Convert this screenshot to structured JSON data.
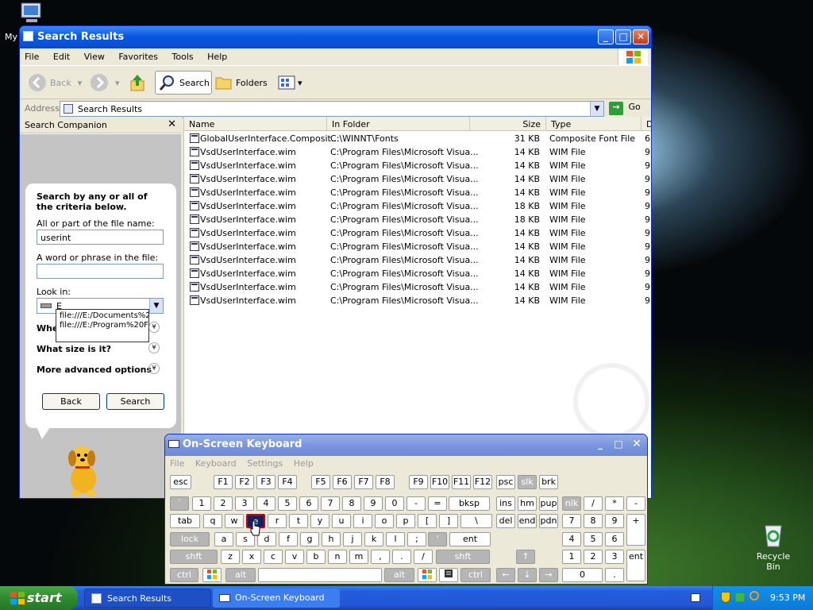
{
  "desktop": {
    "my_label": "My",
    "recycle_bin": "Recycle Bin"
  },
  "search_window": {
    "title": "Search Results",
    "menu": [
      "File",
      "Edit",
      "View",
      "Favorites",
      "Tools",
      "Help"
    ],
    "toolbar": {
      "back": "Back",
      "search": "Search",
      "folders": "Folders"
    },
    "address": {
      "label": "Address",
      "value": "Search Results",
      "go": "Go"
    },
    "companion": {
      "title": "Search Companion",
      "intro": "Search by any or all of the criteria below.",
      "name_label": "All or part of the file name:",
      "name_value": "userint",
      "phrase_label": "A word or phrase in the file:",
      "phrase_value": "",
      "lookin_label": "Look in:",
      "lookin_value": "E",
      "suggestions": [
        "file:///E:/Documents%2",
        "file:///E:/Program%20F"
      ],
      "when_label": "Whe",
      "size_label": "What size is it?",
      "advanced_label": "More advanced options",
      "back_btn": "Back",
      "search_btn": "Search"
    },
    "columns": [
      "Name",
      "In Folder",
      "Size",
      "Type",
      "D"
    ],
    "rows": [
      {
        "name": "GlobalUserInterface.Composit...",
        "folder": "C:\\WINNT\\Fonts",
        "size": "31 KB",
        "type": "Composite Font File",
        "d": "6"
      },
      {
        "name": "VsdUserInterface.wim",
        "folder": "C:\\Program Files\\Microsoft Visua...",
        "size": "14 KB",
        "type": "WIM File",
        "d": "9"
      },
      {
        "name": "VsdUserInterface.wim",
        "folder": "C:\\Program Files\\Microsoft Visua...",
        "size": "14 KB",
        "type": "WIM File",
        "d": "9"
      },
      {
        "name": "VsdUserInterface.wim",
        "folder": "C:\\Program Files\\Microsoft Visua...",
        "size": "14 KB",
        "type": "WIM File",
        "d": "9"
      },
      {
        "name": "VsdUserInterface.wim",
        "folder": "C:\\Program Files\\Microsoft Visua...",
        "size": "14 KB",
        "type": "WIM File",
        "d": "9"
      },
      {
        "name": "VsdUserInterface.wim",
        "folder": "C:\\Program Files\\Microsoft Visua...",
        "size": "18 KB",
        "type": "WIM File",
        "d": "9"
      },
      {
        "name": "VsdUserInterface.wim",
        "folder": "C:\\Program Files\\Microsoft Visua...",
        "size": "18 KB",
        "type": "WIM File",
        "d": "9"
      },
      {
        "name": "VsdUserInterface.wim",
        "folder": "C:\\Program Files\\Microsoft Visua...",
        "size": "14 KB",
        "type": "WIM File",
        "d": "9"
      },
      {
        "name": "VsdUserInterface.wim",
        "folder": "C:\\Program Files\\Microsoft Visua...",
        "size": "14 KB",
        "type": "WIM File",
        "d": "9"
      },
      {
        "name": "VsdUserInterface.wim",
        "folder": "C:\\Program Files\\Microsoft Visua...",
        "size": "14 KB",
        "type": "WIM File",
        "d": "9"
      },
      {
        "name": "VsdUserInterface.wim",
        "folder": "C:\\Program Files\\Microsoft Visua...",
        "size": "14 KB",
        "type": "WIM File",
        "d": "9"
      },
      {
        "name": "VsdUserInterface.wim",
        "folder": "C:\\Program Files\\Microsoft Visua...",
        "size": "14 KB",
        "type": "WIM File",
        "d": "9"
      },
      {
        "name": "VsdUserInterface.wim",
        "folder": "C:\\Program Files\\Microsoft Visua...",
        "size": "14 KB",
        "type": "WIM File",
        "d": "9"
      }
    ]
  },
  "osk": {
    "title": "On-Screen Keyboard",
    "menu": [
      "File",
      "Keyboard",
      "Settings",
      "Help"
    ],
    "row0": [
      "esc",
      "F1",
      "F2",
      "F3",
      "F4",
      "F5",
      "F6",
      "F7",
      "F8",
      "F9",
      "F10",
      "F11",
      "F12",
      "psc",
      "slk",
      "brk"
    ],
    "row1": [
      "`",
      "1",
      "2",
      "3",
      "4",
      "5",
      "6",
      "7",
      "8",
      "9",
      "0",
      "-",
      "=",
      "bksp",
      "ins",
      "hm",
      "pup",
      "nlk",
      "/",
      "*",
      "-"
    ],
    "row2": [
      "tab",
      "q",
      "w",
      "e",
      "r",
      "t",
      "y",
      "u",
      "i",
      "o",
      "p",
      "[",
      "]",
      "\\",
      "del",
      "end",
      "pdn",
      "7",
      "8",
      "9",
      "+"
    ],
    "row3": [
      "lock",
      "a",
      "s",
      "d",
      "f",
      "g",
      "h",
      "j",
      "k",
      "l",
      ";",
      "'",
      "ent",
      "4",
      "5",
      "6"
    ],
    "row4": [
      "shft",
      "z",
      "x",
      "c",
      "v",
      "b",
      "n",
      "m",
      ",",
      ".",
      "/",
      "shft",
      "1",
      "2",
      "3",
      "ent"
    ],
    "row5": [
      "ctrl",
      "alt",
      "alt",
      "ctrl",
      "0",
      "."
    ]
  },
  "taskbar": {
    "start": "start",
    "tasks": [
      "Search Results",
      "On-Screen Keyboard"
    ],
    "clock": "9:53 PM"
  }
}
